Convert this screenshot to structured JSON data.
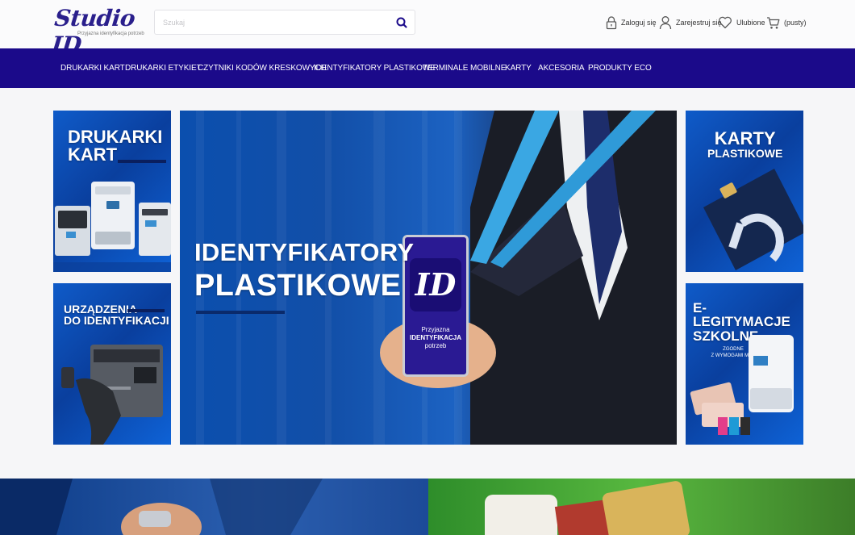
{
  "header": {
    "logo_text": "Studio ID",
    "logo_tagline": "Przyjazna identyfikacja potrzeb",
    "search_placeholder": "Szukaj",
    "login_label": "Zaloguj się",
    "register_label": "Zarejestruj się",
    "favorites_label": "Ulubione",
    "cart_label": "(pusty)"
  },
  "nav": {
    "items": [
      {
        "label": "DRUKARKI KART"
      },
      {
        "label": "DRUKARKI ETYKIET"
      },
      {
        "label": "CZYTNIKI KODÓW KRESKOWYCH"
      },
      {
        "label": "IDENTYFIKATORY PLASTIKOWE"
      },
      {
        "label": "TERMINALE MOBILNE"
      },
      {
        "label": "KARTY"
      },
      {
        "label": "AKCESORIA"
      },
      {
        "label": "PRODUKTY ECO"
      }
    ]
  },
  "tiles": {
    "card_printers": {
      "line1": "DRUKARKI",
      "line2": "KART"
    },
    "id_devices": {
      "line1": "URZĄDZENIA",
      "line2": "DO IDENTYFIKACJI"
    },
    "hero": {
      "line1": "IDENTYFIKATORY",
      "line2": "PLASTIKOWE",
      "badge_logo": "ID",
      "badge_line1": "Przyjazna",
      "badge_line2": "IDENTYFIKACJA",
      "badge_line3": "potrzeb"
    },
    "plastic_cards": {
      "line1": "KARTY",
      "line2": "PLASTIKOWE"
    },
    "e_ids": {
      "line1": "E-LEGITYMACJE",
      "line2": "SZKOLNE",
      "note1": "ZGODNE",
      "note2": "Z WYMOGAMI MEN"
    }
  },
  "colors": {
    "nav_bg": "#1b0a8a",
    "brand": "#2a1f8c",
    "tile_blue": "#0f5bc9"
  },
  "icons": {
    "search": "search-icon",
    "login": "lock-icon",
    "register": "user-icon",
    "favorites": "heart-icon",
    "cart": "cart-icon"
  }
}
